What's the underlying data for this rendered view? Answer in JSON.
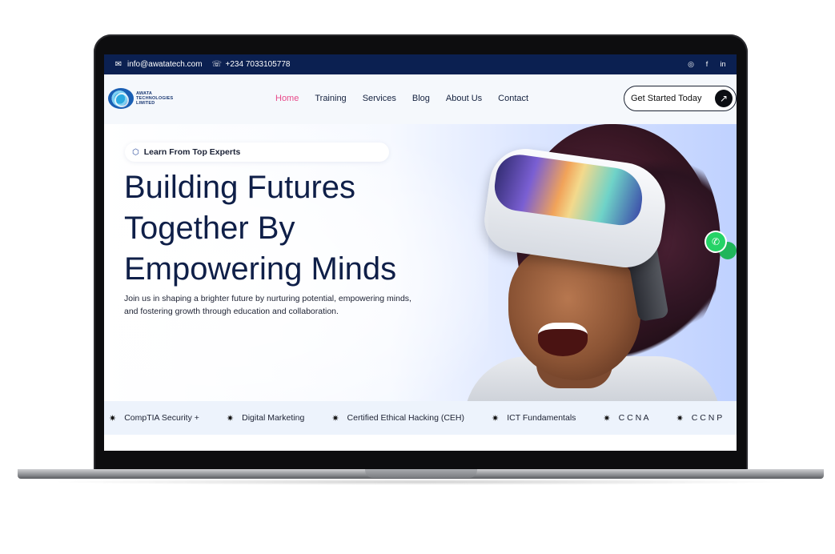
{
  "topbar": {
    "email": "info@awatatech.com",
    "phone": "+234 7033105778",
    "icons": [
      "mail-icon",
      "phone-icon",
      "instagram-icon",
      "facebook-icon",
      "linkedin-icon"
    ]
  },
  "brand": {
    "name_line1": "AWATA",
    "name_line2": "TECHNOLOGIES",
    "name_line3": "LIMITED"
  },
  "nav": {
    "items": [
      {
        "label": "Home",
        "active": true
      },
      {
        "label": "Training",
        "active": false
      },
      {
        "label": "Services",
        "active": false
      },
      {
        "label": "Blog",
        "active": false
      },
      {
        "label": "About Us",
        "active": false
      },
      {
        "label": "Contact",
        "active": false
      }
    ],
    "cta_label": "Get Started Today",
    "cta_icon": "arrow-up-right-icon"
  },
  "hero": {
    "badge": "Learn From Top Experts",
    "headline_lines": [
      "Building Futures",
      "Together By",
      "Empowering Minds"
    ],
    "subtext_line1": "Join us in shaping a brighter future by nurturing potential, empowering minds,",
    "subtext_line2": "and fostering growth through education and collaboration."
  },
  "ticker": {
    "items": [
      "CompTIA Security +",
      "Digital Marketing",
      "Certified Ethical Hacking (CEH)",
      "ICT Fundamentals",
      "C C N A",
      "C C N P"
    ]
  },
  "colors": {
    "topbar_bg": "#0b2051",
    "nav_active": "#e84a8a",
    "headline": "#0f1f48",
    "whatsapp": "#25d366"
  }
}
